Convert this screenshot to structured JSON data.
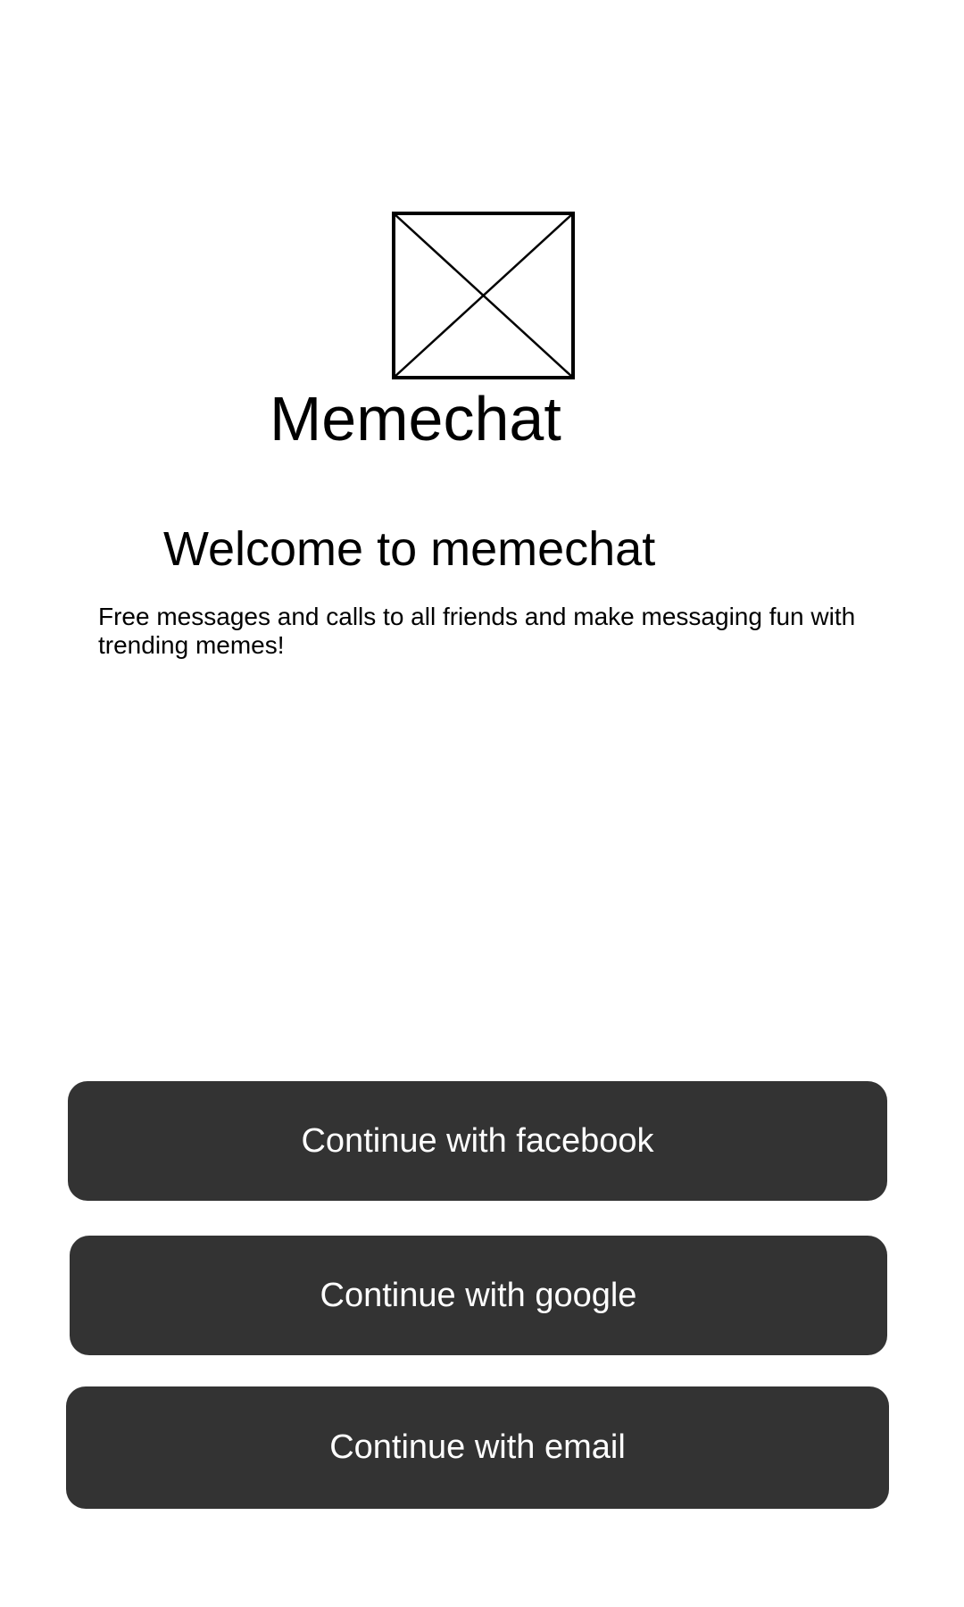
{
  "logo": {
    "icon": "image-placeholder-icon"
  },
  "app_name": "Memechat",
  "welcome_title": "Welcome to memechat",
  "tagline": "Free messages and calls to all friends and make messaging fun with trending memes!",
  "buttons": {
    "facebook": "Continue with facebook",
    "google": "Continue with google",
    "email": "Continue with email"
  },
  "colors": {
    "button_background": "#333333",
    "button_text": "#ffffff",
    "background": "#ffffff",
    "text": "#000000"
  }
}
